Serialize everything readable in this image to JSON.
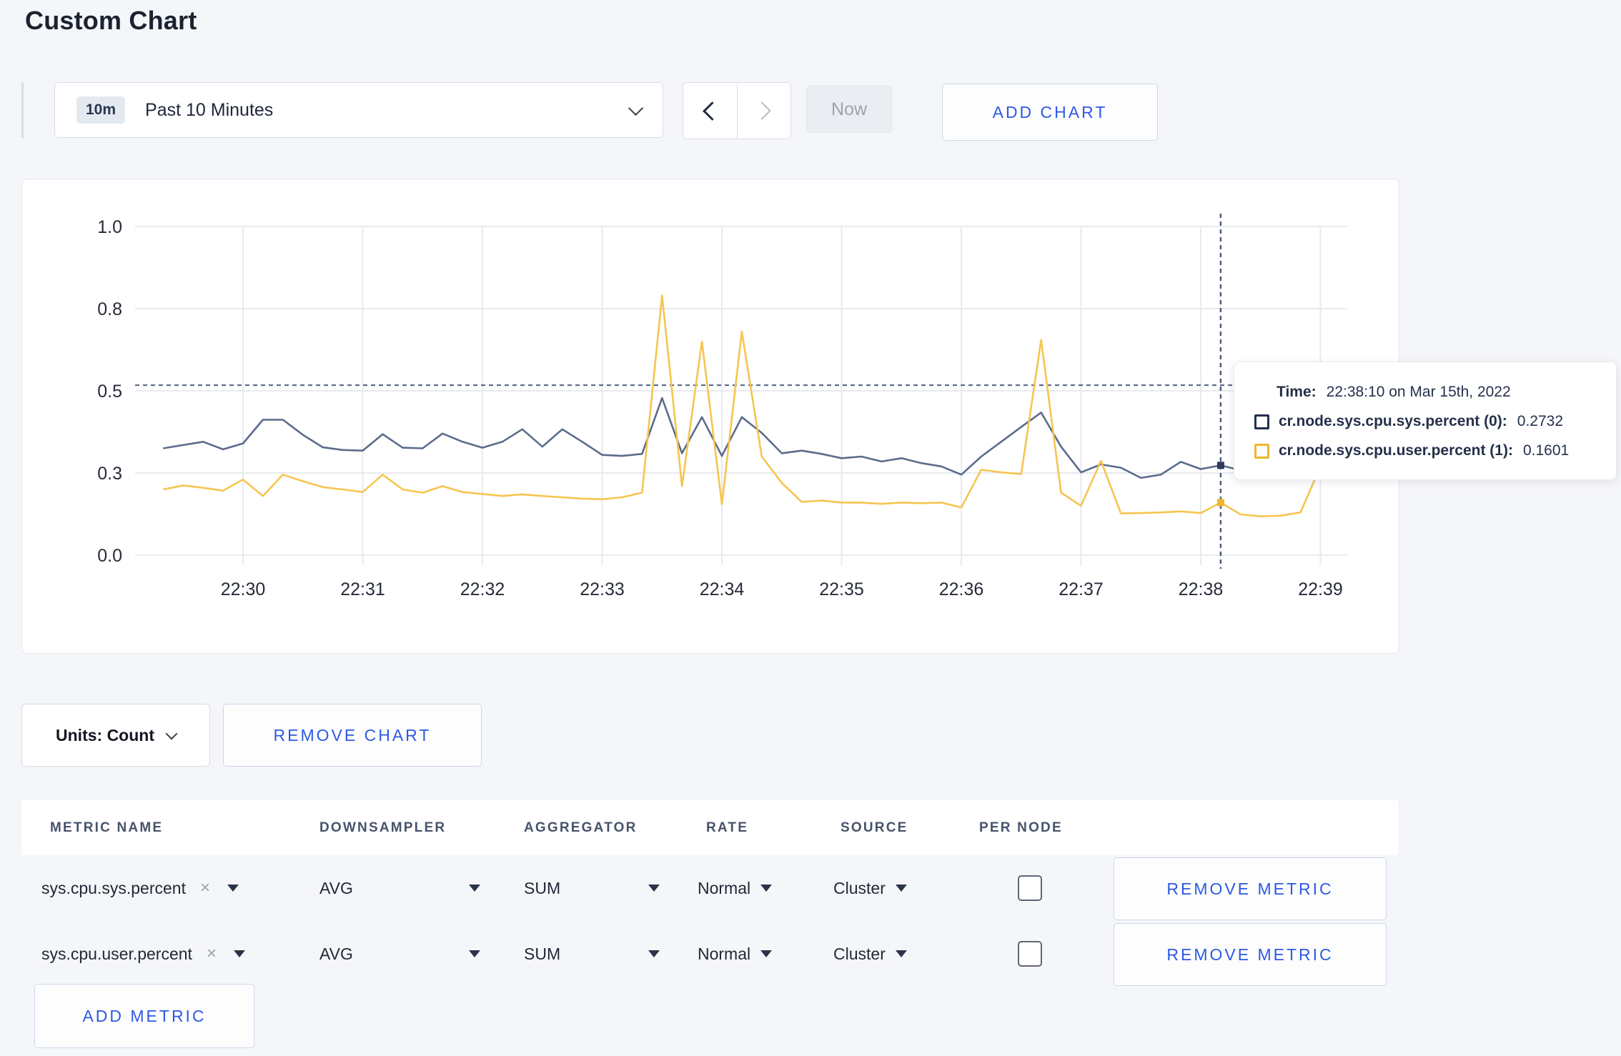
{
  "page": {
    "title": "Custom Chart"
  },
  "toolbar": {
    "time_range": {
      "badge": "10m",
      "label": "Past 10 Minutes"
    },
    "now_label": "Now",
    "add_chart_label": "ADD CHART"
  },
  "tooltip": {
    "time_label": "Time:",
    "time_value": "22:38:10 on Mar 15th, 2022",
    "entries": [
      {
        "label": "cr.node.sys.cpu.sys.percent (0):",
        "value": "0.2732",
        "swatch_color": "#232e4d"
      },
      {
        "label": "cr.node.sys.cpu.user.percent (1):",
        "value": "0.1601",
        "swatch_color": "#f0b62a"
      }
    ]
  },
  "units": {
    "label": "Units: Count"
  },
  "remove_chart_label": "REMOVE CHART",
  "metrics_table": {
    "headers": [
      "METRIC NAME",
      "DOWNSAMPLER",
      "AGGREGATOR",
      "RATE",
      "SOURCE",
      "PER NODE"
    ],
    "rows": [
      {
        "metric": "sys.cpu.sys.percent",
        "clear": "×",
        "downsampler": "AVG",
        "aggregator": "SUM",
        "rate": "Normal",
        "source": "Cluster",
        "per_node_checked": false,
        "remove_label": "REMOVE METRIC"
      },
      {
        "metric": "sys.cpu.user.percent",
        "clear": "×",
        "downsampler": "AVG",
        "aggregator": "SUM",
        "rate": "Normal",
        "source": "Cluster",
        "per_node_checked": false,
        "remove_label": "REMOVE METRIC"
      }
    ],
    "add_metric_label": "ADD METRIC"
  },
  "chart_data": {
    "type": "line",
    "title": "",
    "grid": true,
    "legend_position": "tooltip-on-hover",
    "y_axis": {
      "range": [
        0,
        1
      ],
      "ticks": [
        {
          "v": 0.0,
          "label": "0.0"
        },
        {
          "v": 0.25,
          "label": "0.3"
        },
        {
          "v": 0.5,
          "label": "0.5"
        },
        {
          "v": 0.75,
          "label": "0.8"
        },
        {
          "v": 1.0,
          "label": "1.0"
        }
      ]
    },
    "x_axis": {
      "tick_labels": [
        "22:30",
        "22:31",
        "22:32",
        "22:33",
        "22:34",
        "22:35",
        "22:36",
        "22:37",
        "22:38",
        "22:39"
      ],
      "tick_interval_seconds": 60
    },
    "x_start_seconds": -40,
    "x_step_seconds": 10,
    "series": [
      {
        "name": "cr.node.sys.cpu.sys.percent",
        "color": "#5b6c8c",
        "dot_color": "#2e3a5c",
        "values": [
          0.325,
          0.335,
          0.345,
          0.322,
          0.34,
          0.412,
          0.412,
          0.366,
          0.328,
          0.32,
          0.318,
          0.368,
          0.327,
          0.325,
          0.37,
          0.345,
          0.327,
          0.345,
          0.383,
          0.33,
          0.383,
          0.345,
          0.305,
          0.302,
          0.308,
          0.478,
          0.31,
          0.42,
          0.302,
          0.42,
          0.372,
          0.31,
          0.318,
          0.308,
          0.295,
          0.3,
          0.285,
          0.295,
          0.28,
          0.27,
          0.245,
          0.3,
          0.345,
          0.39,
          0.434,
          0.33,
          0.252,
          0.276,
          0.266,
          0.235,
          0.245,
          0.284,
          0.262,
          0.2732,
          0.258,
          0.285,
          0.3,
          0.295,
          0.29,
          0.3
        ]
      },
      {
        "name": "cr.node.sys.cpu.user.percent",
        "color": "#f6c550",
        "dot_color": "#f0b62a",
        "values": [
          0.2,
          0.212,
          0.205,
          0.196,
          0.23,
          0.18,
          0.245,
          0.225,
          0.207,
          0.2,
          0.192,
          0.245,
          0.2,
          0.19,
          0.21,
          0.192,
          0.186,
          0.18,
          0.185,
          0.18,
          0.176,
          0.172,
          0.17,
          0.176,
          0.19,
          0.79,
          0.21,
          0.65,
          0.155,
          0.68,
          0.3,
          0.22,
          0.162,
          0.166,
          0.16,
          0.16,
          0.156,
          0.16,
          0.158,
          0.16,
          0.145,
          0.26,
          0.252,
          0.247,
          0.655,
          0.19,
          0.15,
          0.287,
          0.127,
          0.128,
          0.13,
          0.133,
          0.128,
          0.1601,
          0.124,
          0.118,
          0.12,
          0.13,
          0.27,
          0.245
        ]
      }
    ],
    "crosshair": {
      "x_seconds": 490,
      "hline_value": 0.517
    }
  }
}
